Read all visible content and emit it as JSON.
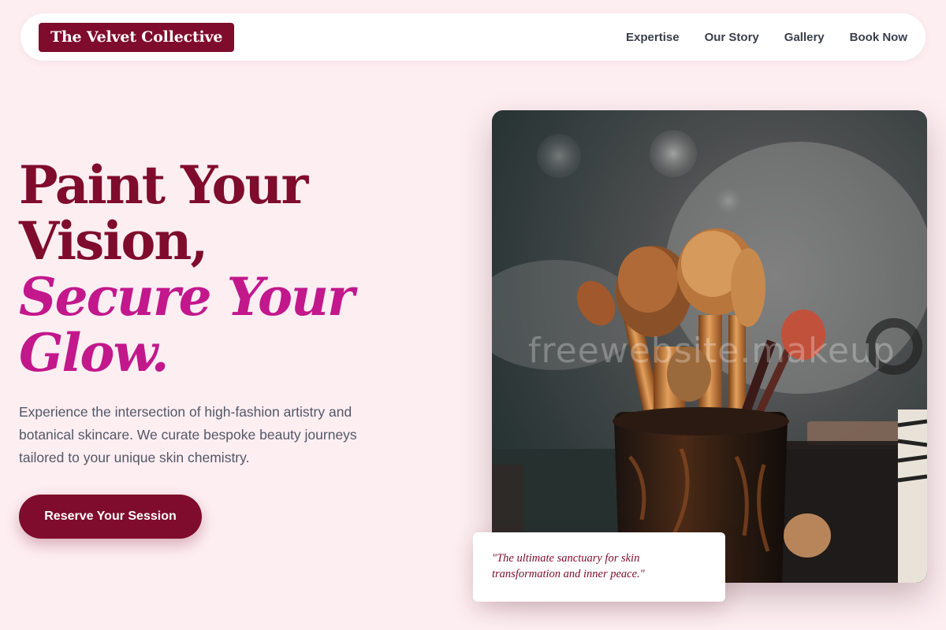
{
  "nav": {
    "brand": "The Velvet Collective",
    "links": [
      {
        "label": "Expertise"
      },
      {
        "label": "Our Story"
      },
      {
        "label": "Gallery"
      },
      {
        "label": "Book Now"
      }
    ]
  },
  "hero": {
    "title_line1": "Paint Your",
    "title_line2": "Vision,",
    "title_accent1": "Secure Your",
    "title_accent2": "Glow.",
    "description": "Experience the intersection of high-fashion artistry and botanical skincare. We curate bespoke beauty journeys tailored to your unique skin chemistry.",
    "cta_label": "Reserve Your Session"
  },
  "image": {
    "subject": "makeup brushes in a cup",
    "watermark": "freewebsite.makeup"
  },
  "quote": {
    "text": "\"The ultimate sanctuary for skin transformation and inner peace.\""
  },
  "colors": {
    "background": "#fdeef2",
    "brand": "#7f0c2c",
    "accent": "#c2188c",
    "body_text": "#525866",
    "nav_text": "#3a3f4b"
  }
}
